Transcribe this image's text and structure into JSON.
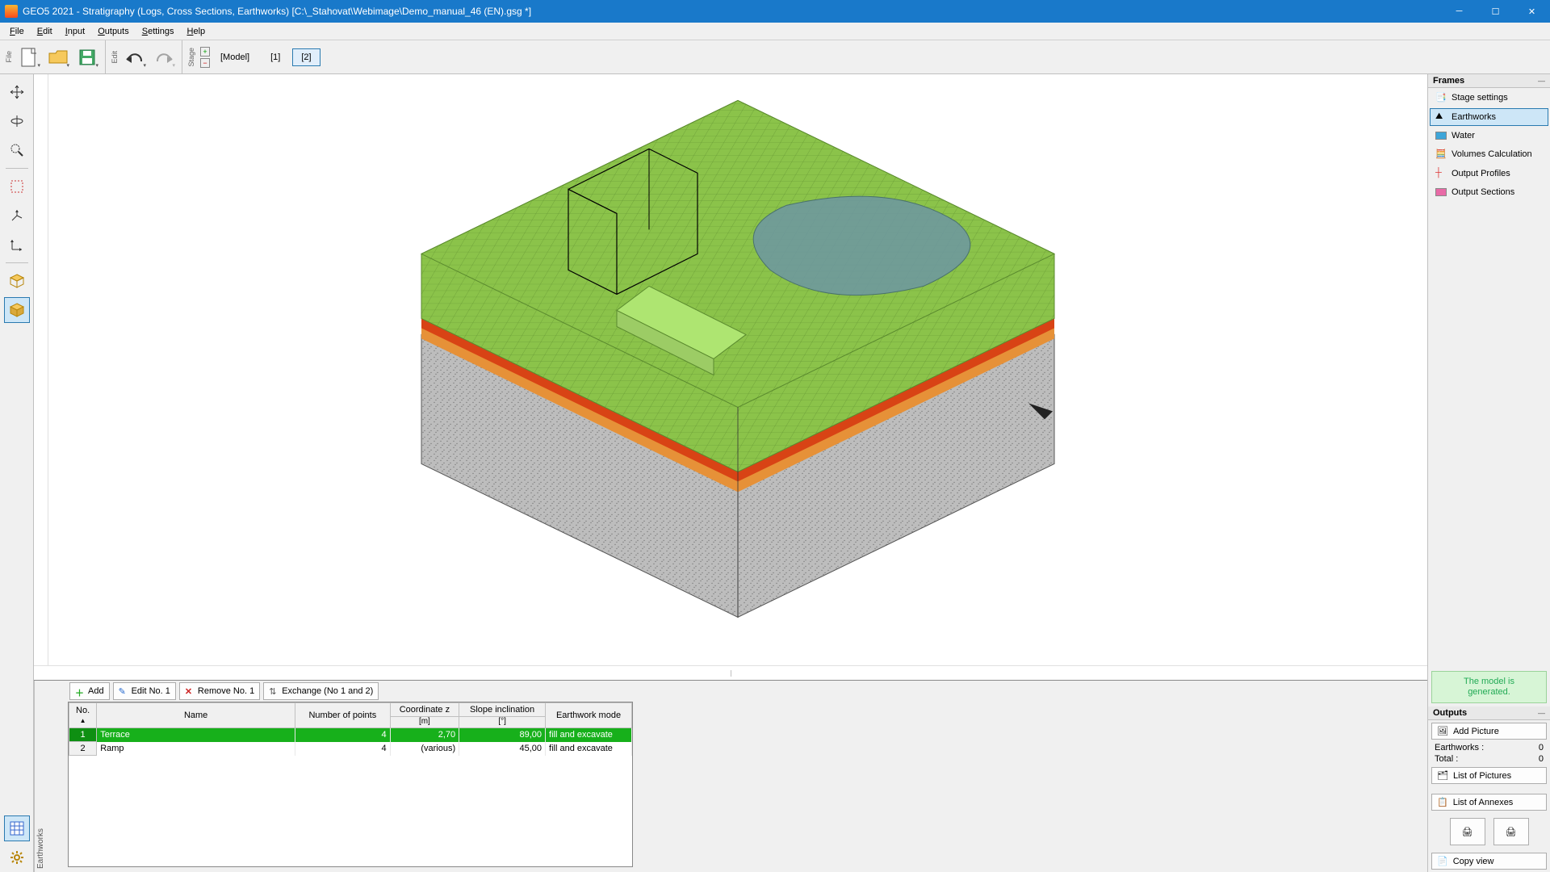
{
  "title": "GEO5 2021 - Stratigraphy (Logs, Cross Sections, Earthworks) [C:\\_Stahovat\\Webimage\\Demo_manual_46 (EN).gsg *]",
  "menu": {
    "file": "File",
    "edit": "Edit",
    "input": "Input",
    "outputs": "Outputs",
    "settings": "Settings",
    "help": "Help"
  },
  "toolbar": {
    "file_label": "File",
    "edit_label": "Edit",
    "stage_label": "Stage"
  },
  "stages": {
    "model": "[Model]",
    "s1": "[1]",
    "s2": "[2]"
  },
  "frames": {
    "header": "Frames",
    "stage_settings": "Stage settings",
    "earthworks": "Earthworks",
    "water": "Water",
    "volumes": "Volumes Calculation",
    "profiles": "Output Profiles",
    "sections": "Output Sections"
  },
  "status": {
    "line1": "The model is",
    "line2": "generated."
  },
  "outputs": {
    "header": "Outputs",
    "add_picture": "Add Picture",
    "earthworks_label": "Earthworks :",
    "earthworks_count": "0",
    "total_label": "Total :",
    "total_count": "0",
    "list_pictures": "List of Pictures",
    "list_annexes": "List of Annexes",
    "copy_view": "Copy view"
  },
  "bottom": {
    "label": "Earthworks",
    "add": "Add",
    "edit": "Edit No. 1",
    "remove": "Remove No. 1",
    "exchange": "Exchange (No 1 and 2)",
    "cols": {
      "no": "No.",
      "name": "Name",
      "points": "Number of points",
      "coord": "Coordinate z",
      "coord_unit": "[m]",
      "slope": "Slope inclination",
      "slope_unit": "[°]",
      "mode": "Earthwork mode"
    },
    "rows": [
      {
        "no": "1",
        "name": "Terrace",
        "points": "4",
        "coord": "2,70",
        "slope": "89,00",
        "mode": "fill and excavate"
      },
      {
        "no": "2",
        "name": "Ramp",
        "points": "4",
        "coord": "(various)",
        "slope": "45,00",
        "mode": "fill and excavate"
      }
    ]
  }
}
